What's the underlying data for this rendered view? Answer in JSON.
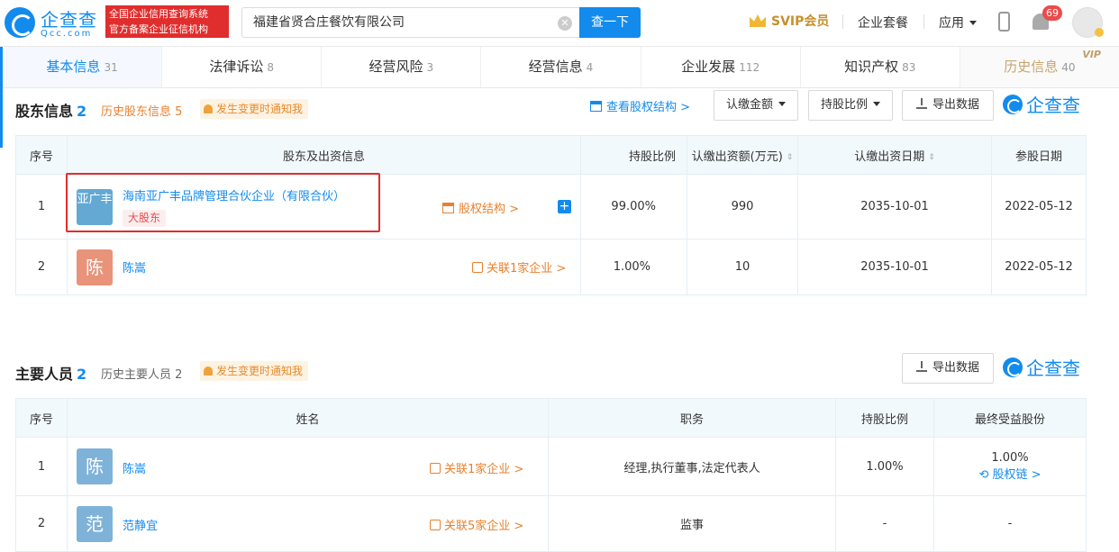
{
  "header": {
    "logo_text": "企查查",
    "logo_domain": "Qcc.com",
    "slogan_line1": "全国企业信用查询系统",
    "slogan_line2": "官方备案企业征信机构",
    "search_value": "福建省贤合庄餐饮有限公司",
    "search_button": "查一下",
    "svip_label": "SVIP会员",
    "enterprise_package": "企业套餐",
    "apps": "应用",
    "notification_count": "69"
  },
  "tabs": [
    {
      "label": "基本信息",
      "count": "31"
    },
    {
      "label": "法律诉讼",
      "count": "8"
    },
    {
      "label": "经营风险",
      "count": "3"
    },
    {
      "label": "经营信息",
      "count": "4"
    },
    {
      "label": "企业发展",
      "count": "112"
    },
    {
      "label": "知识产权",
      "count": "83"
    },
    {
      "label": "历史信息",
      "count": "40",
      "tag": "VIP"
    }
  ],
  "shareholders": {
    "title": "股东信息",
    "count": "2",
    "history": "历史股东信息 5",
    "notify": "发生变更时通知我",
    "view_structure": "查看股权结构 >",
    "btn_amount": "认缴金额",
    "btn_ratio": "持股比例",
    "btn_export": "导出数据",
    "brand": "企查查",
    "columns": [
      "序号",
      "股东及出资信息",
      "持股比例",
      "认缴出资额(万元)",
      "认缴出资日期",
      "参股日期"
    ],
    "rows": [
      {
        "no": "1",
        "avatar": "亚广丰",
        "name": "海南亚广丰品牌管理合伙企业（有限合伙）",
        "tag": "大股东",
        "action": "股权结构 >",
        "ratio": "99.00%",
        "amount": "990",
        "pay_date": "2035-10-01",
        "join_date": "2022-05-12"
      },
      {
        "no": "2",
        "avatar": "陈",
        "name": "陈嵩",
        "action": "关联1家企业 >",
        "ratio": "1.00%",
        "amount": "10",
        "pay_date": "2035-10-01",
        "join_date": "2022-05-12"
      }
    ]
  },
  "personnel": {
    "title": "主要人员",
    "count": "2",
    "history": "历史主要人员 2",
    "notify": "发生变更时通知我",
    "btn_export": "导出数据",
    "brand": "企查查",
    "columns": [
      "序号",
      "姓名",
      "职务",
      "持股比例",
      "最终受益股份"
    ],
    "rows": [
      {
        "no": "1",
        "avatar": "陈",
        "name": "陈嵩",
        "action": "关联1家企业 >",
        "role": "经理,执行董事,法定代表人",
        "ratio": "1.00%",
        "benefit": "1.00%",
        "chain": "股权链 >"
      },
      {
        "no": "2",
        "avatar": "范",
        "name": "范静宜",
        "action": "关联5家企业 >",
        "role": "监事",
        "ratio": "-",
        "benefit": "-"
      }
    ]
  },
  "colors": {
    "brand_blue": "#128bed",
    "orange": "#e8812e",
    "red": "#e02d2d"
  }
}
